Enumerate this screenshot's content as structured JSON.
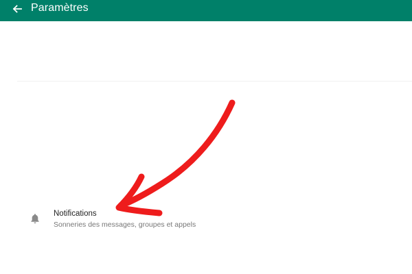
{
  "header": {
    "title": "Paramètres",
    "back_icon": "arrow-left-icon",
    "background_color": "#008069"
  },
  "settings": {
    "items": [
      {
        "title": "Notifications",
        "subtitle": "Sonneries des messages, groupes et appels",
        "icon": "bell-icon"
      }
    ]
  },
  "annotation": {
    "type": "hand-drawn arrow",
    "color": "#ee1c1c"
  }
}
